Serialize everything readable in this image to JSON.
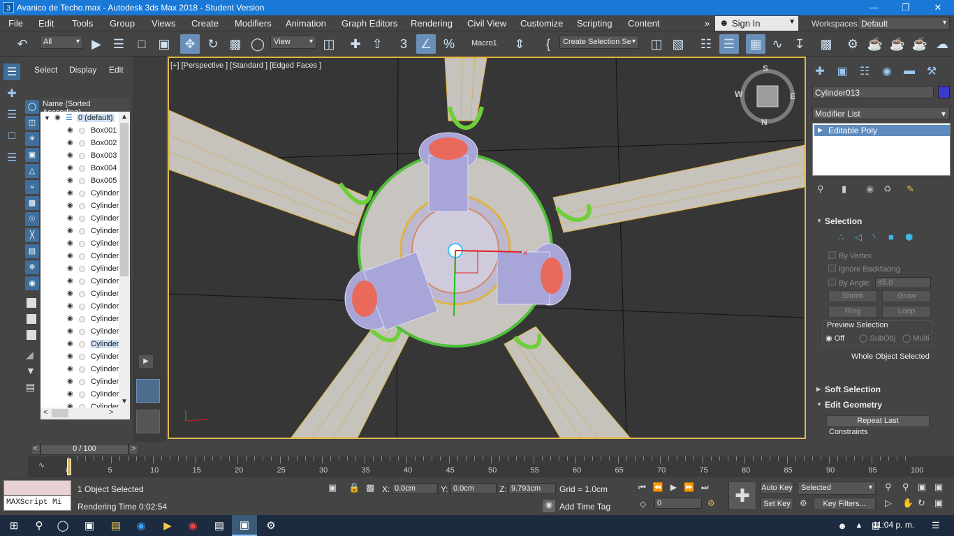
{
  "window": {
    "title": "Avanico de Techo.max - Autodesk 3ds Max 2018 - Student Version",
    "app_icon": "3",
    "minimize": "—",
    "restore": "❐",
    "close": "✕"
  },
  "menu": [
    "File",
    "Edit",
    "Tools",
    "Group",
    "Views",
    "Create",
    "Modifiers",
    "Animation",
    "Graph Editors",
    "Rendering",
    "Civil View",
    "Customize",
    "Scripting",
    "Content"
  ],
  "menu_more": "»",
  "signin": {
    "label": "Sign In"
  },
  "workspace": {
    "label": "Workspaces:",
    "value": "Default"
  },
  "toolbar": {
    "filter": "All",
    "ref_coord": "View",
    "macro": "Macro1",
    "selection_set": "Create Selection Se",
    "snap_3": "3",
    "percent": "%"
  },
  "explorer": {
    "tabs": [
      "Select",
      "Display",
      "Edit"
    ],
    "column_header": "Name (Sorted Ascending)",
    "layer": "0 (default)",
    "items": [
      "Box001",
      "Box002",
      "Box003",
      "Box004",
      "Box005",
      "Cylinder",
      "Cylinder",
      "Cylinder",
      "Cylinder",
      "Cylinder",
      "Cylinder",
      "Cylinder",
      "Cylinder",
      "Cylinder",
      "Cylinder",
      "Cylinder",
      "Cylinder",
      "Cylinder",
      "Cylinder",
      "Cylinder",
      "Cylinder",
      "Cylinder",
      "Cylinder"
    ]
  },
  "viewport": {
    "label": "[+] [Perspective ] [Standard ] [Edged Faces ]",
    "viewcube": {
      "top": "S",
      "left": "W",
      "right": "E",
      "bottom": "N"
    }
  },
  "command_panel": {
    "object_name": "Cylinder013",
    "object_color": "#3a3acc",
    "modifier_list": "Modifier List",
    "stack_item": "Editable Poly",
    "selection": {
      "title": "Selection",
      "by_vertex": "By Vertex",
      "ignore_backfacing": "Ignore Backfacing",
      "by_angle": "By Angle:",
      "angle_value": "45.0",
      "shrink": "Shrink",
      "grow": "Grow",
      "ring": "Ring",
      "loop": "Loop",
      "preview_title": "Preview Selection",
      "preview_off": "Off",
      "preview_subobj": "SubObj",
      "preview_multi": "Multi",
      "status": "Whole Object Selected"
    },
    "soft_selection": "Soft Selection",
    "edit_geometry": {
      "title": "Edit Geometry",
      "repeat_last": "Repeat Last",
      "constraints": "Constraints"
    }
  },
  "timeline": {
    "frame": "0 / 100",
    "prev": "<",
    "next": ">",
    "ticks": [
      "0",
      "5",
      "10",
      "15",
      "20",
      "25",
      "30",
      "35",
      "40",
      "45",
      "50",
      "55",
      "60",
      "65",
      "70",
      "75",
      "80",
      "85",
      "90",
      "95",
      "100"
    ]
  },
  "status": {
    "maxscript": "MAXScript Mi",
    "selected": "1 Object Selected",
    "render_time": "Rendering Time  0:02:54",
    "x_label": "X:",
    "x": "0.0cm",
    "y_label": "Y:",
    "y": "0.0cm",
    "z_label": "Z:",
    "z": "9.793cm",
    "grid": "Grid = 1.0cm",
    "add_time_tag": "Add Time Tag",
    "auto_key": "Auto Key",
    "set_key": "Set Key",
    "key_mode": "Selected",
    "key_filters": "Key Filters...",
    "current_frame": "0"
  },
  "taskbar": {
    "time": "11:04 p. m."
  },
  "colors": {
    "accent": "#1a78d6",
    "viewport_border": "#e3b94a",
    "selection_blue": "#5e8bbd"
  }
}
